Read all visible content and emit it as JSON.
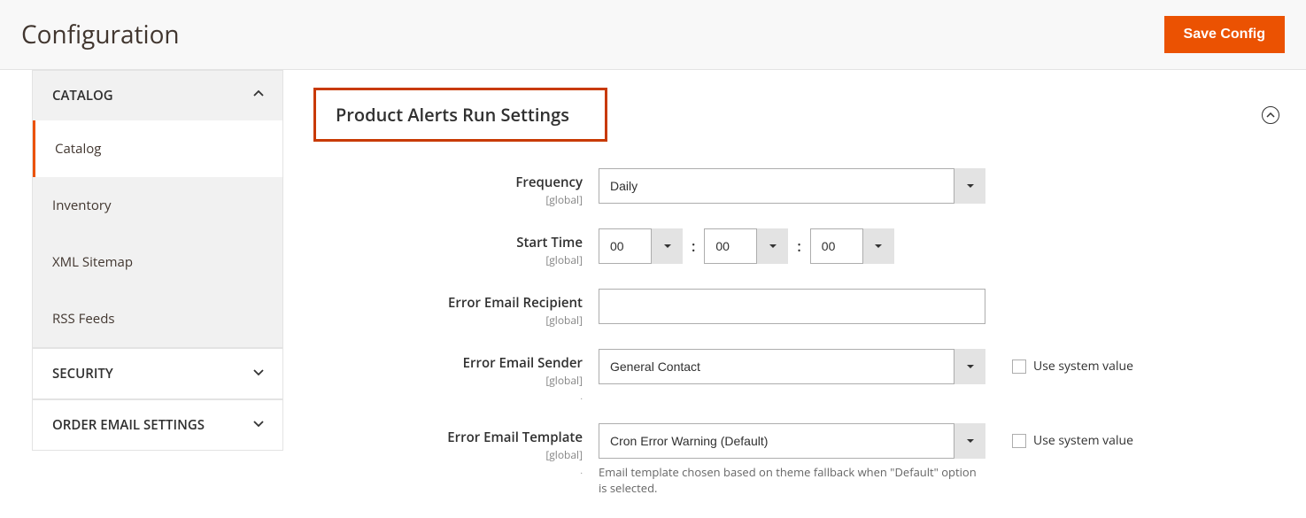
{
  "header": {
    "title": "Configuration",
    "save_button": "Save Config"
  },
  "sidebar": {
    "groups": [
      {
        "label": "CATALOG",
        "expanded": true,
        "items": [
          {
            "label": "Catalog",
            "active": true
          },
          {
            "label": "Inventory",
            "active": false
          },
          {
            "label": "XML Sitemap",
            "active": false
          },
          {
            "label": "RSS Feeds",
            "active": false
          }
        ]
      },
      {
        "label": "SECURITY",
        "expanded": false,
        "items": []
      },
      {
        "label": "ORDER EMAIL SETTINGS",
        "expanded": false,
        "items": []
      }
    ]
  },
  "section": {
    "title": "Product Alerts Run Settings"
  },
  "fields": {
    "frequency": {
      "label": "Frequency",
      "scope": "[global]",
      "value": "Daily"
    },
    "start_time": {
      "label": "Start Time",
      "scope": "[global]",
      "hour": "00",
      "minute": "00",
      "second": "00"
    },
    "error_recipient": {
      "label": "Error Email Recipient",
      "scope": "[global]",
      "value": ""
    },
    "error_sender": {
      "label": "Error Email Sender",
      "scope": "[global]",
      "value": "General Contact",
      "use_system_label": "Use system value"
    },
    "error_template": {
      "label": "Error Email Template",
      "scope": "[global]",
      "value": "Cron Error Warning (Default)",
      "use_system_label": "Use system value",
      "help": "Email template chosen based on theme fallback when \"Default\" option is selected."
    }
  }
}
